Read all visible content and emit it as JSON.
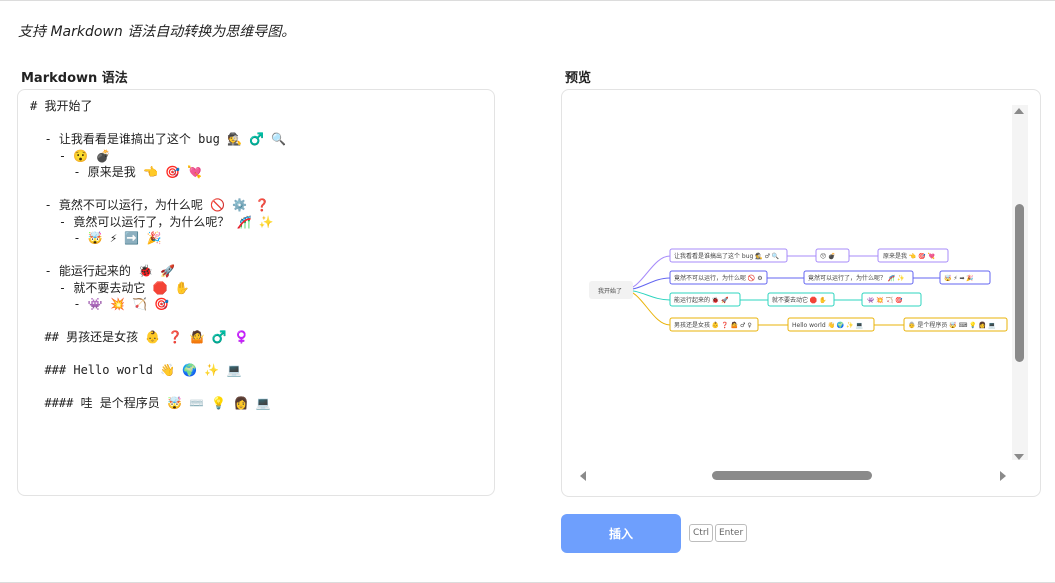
{
  "header": {
    "subtitle": "支持 Markdown 语法自动转换为思维导图。"
  },
  "editor": {
    "label": "Markdown 语法",
    "lines": [
      "# 我开始了",
      "",
      "  - 让我看看是谁搞出了这个 bug 🕵️ ♂️ 🔍",
      "    - 😯 💣",
      "      - 原来是我 👈 🎯 💘",
      "",
      "  - 竟然不可以运行，为什么呢 🚫 ⚙️ ❓",
      "    - 竟然可以运行了，为什么呢？ 🎢 ✨",
      "      - 🤯 ⚡ ➡️ 🎉",
      "",
      "  - 能运行起来的 🐞 🚀",
      "    - 就不要去动它 🛑 ✋",
      "      - 👾 💥 🏹 🎯",
      "",
      "  ## 男孩还是女孩 👶 ❓ 🤷 ♂️ ♀️",
      "",
      "  ### Hello world 👋 🌍 ✨ 💻",
      "",
      "  #### 哇 是个程序员 🤯 ⌨️ 💡 👩 💻"
    ]
  },
  "preview": {
    "label": "预览",
    "root": "我开始了",
    "nodes": {
      "b1": "让我看看是谁搞出了这个 bug 🕵 ♂ 🔍",
      "b1c": "😯 💣",
      "b1cc": "原来是我 👈 🎯 💘",
      "b2": "竟然不可以运行，为什么呢 🚫 ⚙",
      "b2c": "竟然可以运行了，为什么呢？ 🎢 ✨",
      "b2cc": "🤯 ⚡ ➡ 🎉",
      "b3": "能运行起来的 🐞 🚀",
      "b3c": "就不要去动它 🛑 ✋",
      "b3cc": "👾 💥 🏹 🎯",
      "b4": "男孩还是女孩 👶 ❓ 🤷 ♂ ♀",
      "b4c": "Hello world 👋 🌍 ✨ 💻",
      "b4cc": "👵 是个程序员 🤯 ⌨ 💡 👩 💻"
    },
    "colors": {
      "purple": "#a78bfa",
      "blue": "#6366f1",
      "teal": "#2dd4bf",
      "gold": "#eab308"
    }
  },
  "actions": {
    "insert_label": "插入",
    "shortcut_key1": "Ctrl",
    "shortcut_key2": "Enter"
  }
}
